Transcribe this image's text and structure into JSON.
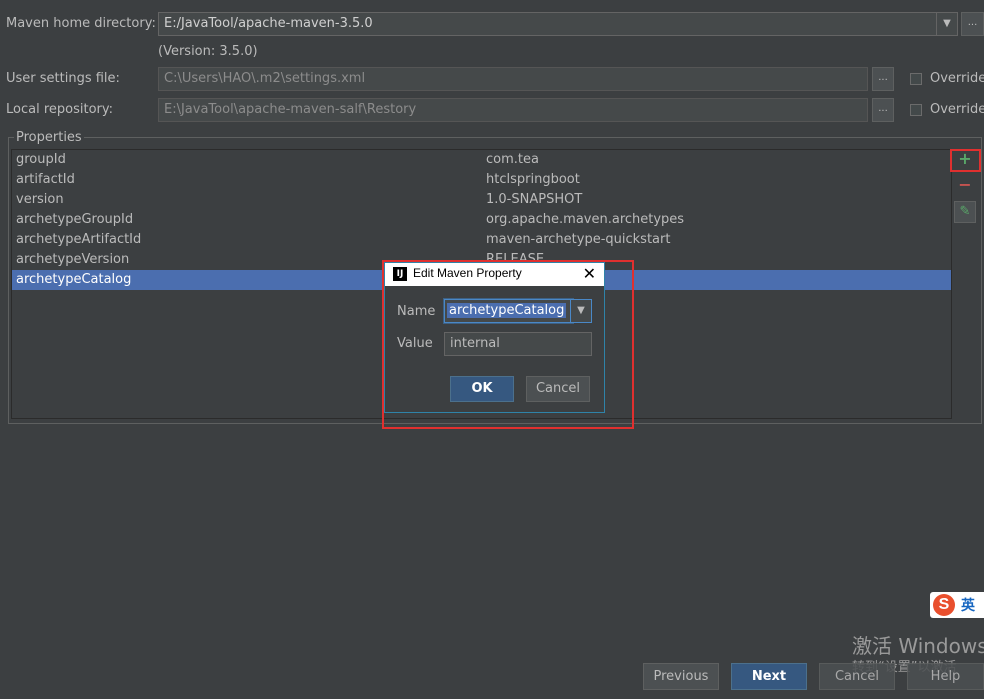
{
  "settings": {
    "maven_home_label": "Maven home directory:",
    "maven_home_value": "E:/JavaTool/apache-maven-3.5.0",
    "version_text": "(Version: 3.5.0)",
    "user_settings_label": "User settings file:",
    "user_settings_value": "C:\\Users\\HAO\\.m2\\settings.xml",
    "local_repo_label": "Local repository:",
    "local_repo_value": "E:\\JavaTool\\apache-maven-salf\\Restory",
    "override_label": "Override",
    "browse_label": "..."
  },
  "properties": {
    "title": "Properties",
    "rows": [
      {
        "key": "groupId",
        "value": "com.tea"
      },
      {
        "key": "artifactId",
        "value": "htclspringboot"
      },
      {
        "key": "version",
        "value": "1.0-SNAPSHOT"
      },
      {
        "key": "archetypeGroupId",
        "value": "org.apache.maven.archetypes"
      },
      {
        "key": "archetypeArtifactId",
        "value": "maven-archetype-quickstart"
      },
      {
        "key": "archetypeVersion",
        "value": "RELEASE"
      },
      {
        "key": "archetypeCatalog",
        "value": ""
      }
    ],
    "add_icon": "+",
    "remove_icon": "−",
    "edit_icon": "✎"
  },
  "dialog": {
    "logo_text": "IJ",
    "title": "Edit Maven Property",
    "close_icon": "✕",
    "name_label": "Name",
    "name_value": "archetypeCatalog",
    "value_label": "Value",
    "value_value": "internal",
    "ok_label": "OK",
    "cancel_label": "Cancel"
  },
  "footer": {
    "previous_label": "Previous",
    "next_label": "Next",
    "cancel_label": "Cancel",
    "help_label": "Help"
  },
  "overlay": {
    "activate_windows": "激活 Windows",
    "activate_hint": "转到“设置”以激活",
    "ime_logo": "S",
    "ime_lang": "英"
  },
  "colors": {
    "selection": "#4b6eaf",
    "highlight_red": "#e0302f",
    "add_green": "#59a869",
    "remove_red": "#c75450"
  }
}
